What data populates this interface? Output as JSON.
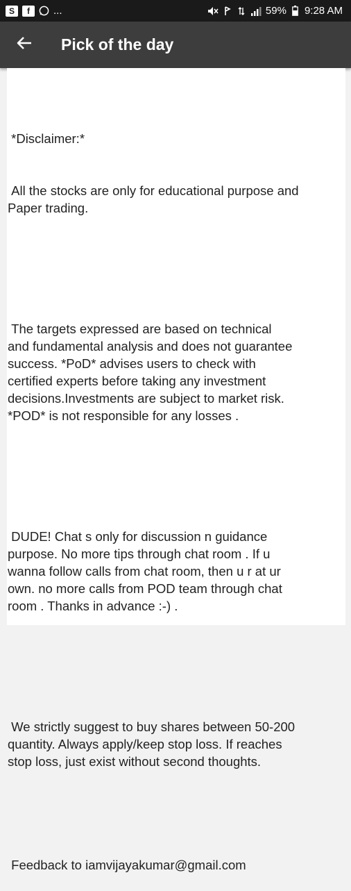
{
  "status_bar": {
    "icons_left": [
      "app-icon",
      "facebook-icon",
      "whatsapp-icon"
    ],
    "more": "...",
    "battery": "59%",
    "time": "9:28 AM"
  },
  "app_bar": {
    "title": "Pick of the day",
    "back_icon": "arrow-left-icon"
  },
  "content": {
    "disclaimer_heading": " *Disclaimer:*",
    "p1": " All the stocks are only for educational purpose and\nPaper trading.",
    "p2": " The targets expressed are based on technical\nand fundamental analysis and does not guarantee\nsuccess. *PoD* advises users to check with\ncertified experts before taking any investment\ndecisions.Investments are subject to market risk.\n*POD* is not responsible for any losses .",
    "p3": " DUDE! Chat s only for discussion n guidance\npurpose. No more tips through chat room . If u\nwanna follow calls from chat room, then u r at ur\nown. no more calls from POD team through chat\nroom . Thanks in advance :-) .",
    "p4": " We strictly suggest to buy shares between 50-200\nquantity. Always apply/keep stop loss. If reaches\nstop loss, just exist without second thoughts.",
    "feedback": " Feedback to iamvijayakumar@gmail.com"
  },
  "colors": {
    "status_bar_bg": "#1a1a1a",
    "app_bar_bg": "#3d3d3d",
    "page_bg": "#f2f2f2",
    "card_bg": "#ffffff",
    "text": "#222222"
  }
}
